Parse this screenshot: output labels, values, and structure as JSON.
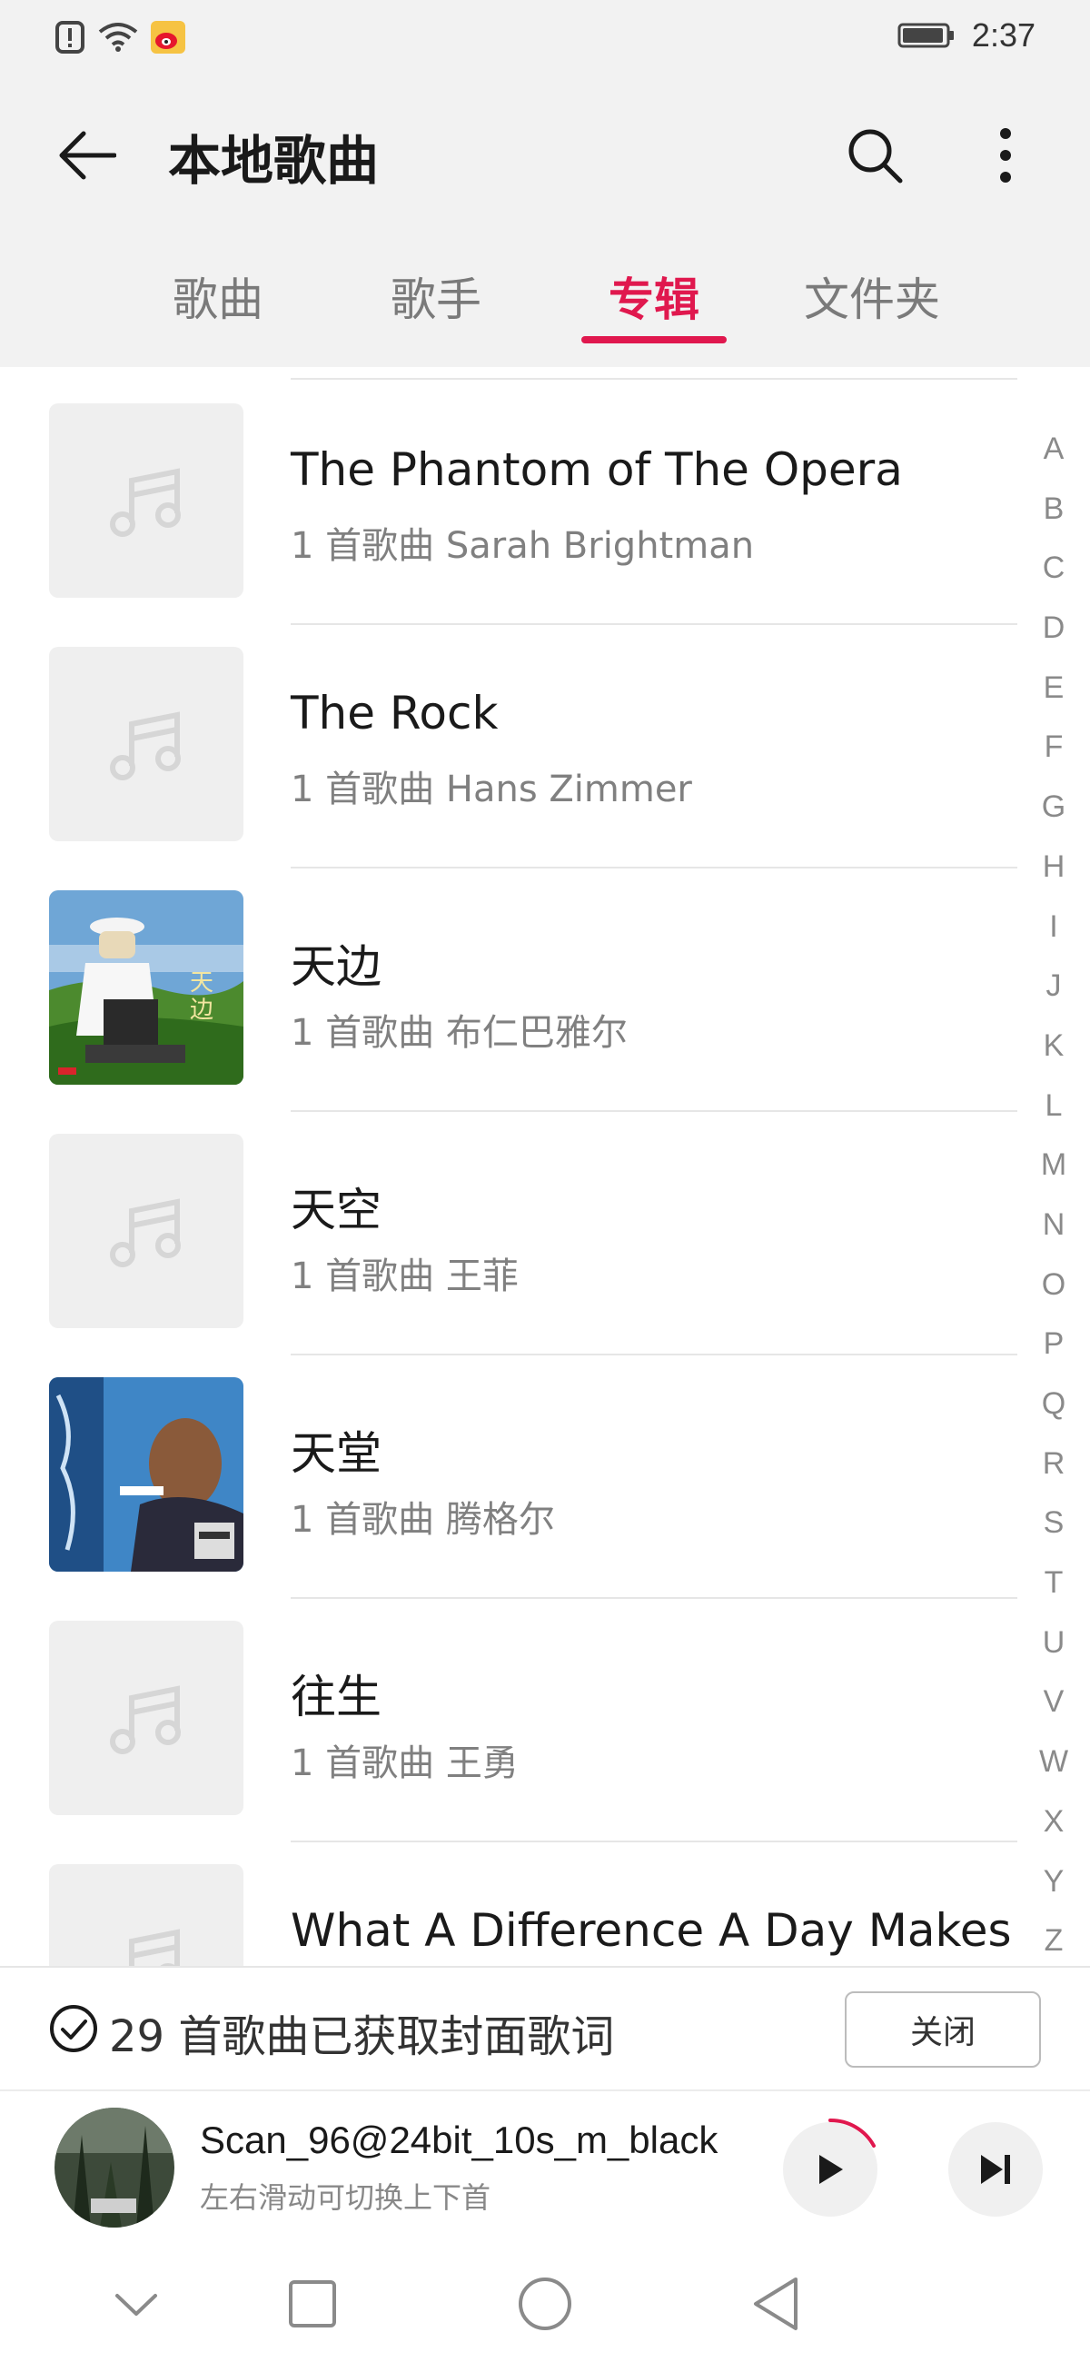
{
  "status_bar": {
    "time": "2:37",
    "left_icons": [
      "alert-icon",
      "wifi-icon",
      "weibo-icon"
    ],
    "right_icons": [
      "battery-icon"
    ]
  },
  "header": {
    "title": "本地歌曲",
    "back_icon": "back-arrow-icon",
    "search_icon": "search-icon",
    "more_icon": "more-vertical-icon"
  },
  "tabs": [
    {
      "label": "歌曲",
      "active": false
    },
    {
      "label": "歌手",
      "active": false
    },
    {
      "label": "专辑",
      "active": true
    },
    {
      "label": "文件夹",
      "active": false
    }
  ],
  "albums": [
    {
      "title": "The Phantom of The Opera",
      "subtitle": "1 首歌曲 Sarah Brightman",
      "cover": "music-note-placeholder"
    },
    {
      "title": "The Rock",
      "subtitle": "1 首歌曲 Hans Zimmer",
      "cover": "music-note-placeholder"
    },
    {
      "title": "天边",
      "subtitle": "1 首歌曲 布仁巴雅尔",
      "cover": "album-art-grassland"
    },
    {
      "title": "天空",
      "subtitle": "1 首歌曲 王菲",
      "cover": "music-note-placeholder"
    },
    {
      "title": "天堂",
      "subtitle": "1 首歌曲 腾格尔",
      "cover": "album-art-blue-wolf"
    },
    {
      "title": "往生",
      "subtitle": "1 首歌曲 王勇",
      "cover": "music-note-placeholder"
    },
    {
      "title": "What A Difference A Day Makes",
      "subtitle": "",
      "cover": "music-note-placeholder"
    }
  ],
  "alphabet": [
    "A",
    "B",
    "C",
    "D",
    "E",
    "F",
    "G",
    "H",
    "I",
    "J",
    "K",
    "L",
    "M",
    "N",
    "O",
    "P",
    "Q",
    "R",
    "S",
    "T",
    "U",
    "V",
    "W",
    "X",
    "Y",
    "Z"
  ],
  "toast": {
    "text": "29 首歌曲已获取封面歌词",
    "close_label": "关闭",
    "icon": "check-circle-icon"
  },
  "player": {
    "title": "Scan_96@24bit_10s_m_black",
    "hint": "左右滑动可切换上下首",
    "play_icon": "play-icon",
    "next_icon": "skip-next-icon",
    "progress": 0.12
  },
  "navbar": {
    "icons": [
      "chevron-down-icon",
      "recents-square-icon",
      "home-circle-icon",
      "back-triangle-icon"
    ]
  },
  "colors": {
    "accent": "#e0184e",
    "header_bg": "#f2f2f2",
    "text_secondary": "#808080"
  }
}
